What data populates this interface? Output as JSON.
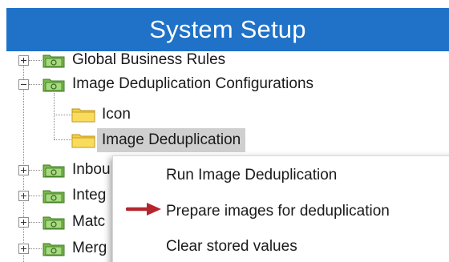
{
  "window": {
    "title": "System Setup"
  },
  "tree": {
    "nodes": [
      {
        "label": "Global Business Rules"
      },
      {
        "label": "Image Deduplication Configurations"
      },
      {
        "label": "Icon"
      },
      {
        "label": "Image Deduplication"
      },
      {
        "label": "Inbou"
      },
      {
        "label": "Integ"
      },
      {
        "label": "Matc"
      },
      {
        "label": "Merg"
      }
    ]
  },
  "context_menu": {
    "items": [
      {
        "label": "Run Image Deduplication"
      },
      {
        "label": "Prepare images for deduplication"
      },
      {
        "label": "Clear stored values"
      }
    ]
  },
  "icons": {
    "expand": "plus-box-icon",
    "collapse": "minus-box-icon",
    "green_folder": "green-folder-icon",
    "yellow_folder": "yellow-folder-icon",
    "pointer": "red-arrow-icon"
  },
  "colors": {
    "title_bar": "#1f72c8",
    "selection": "#cfcfcf",
    "arrow": "#b3262d",
    "folder_yellow": "#f6cf3e",
    "folder_green": "#78b84a"
  }
}
